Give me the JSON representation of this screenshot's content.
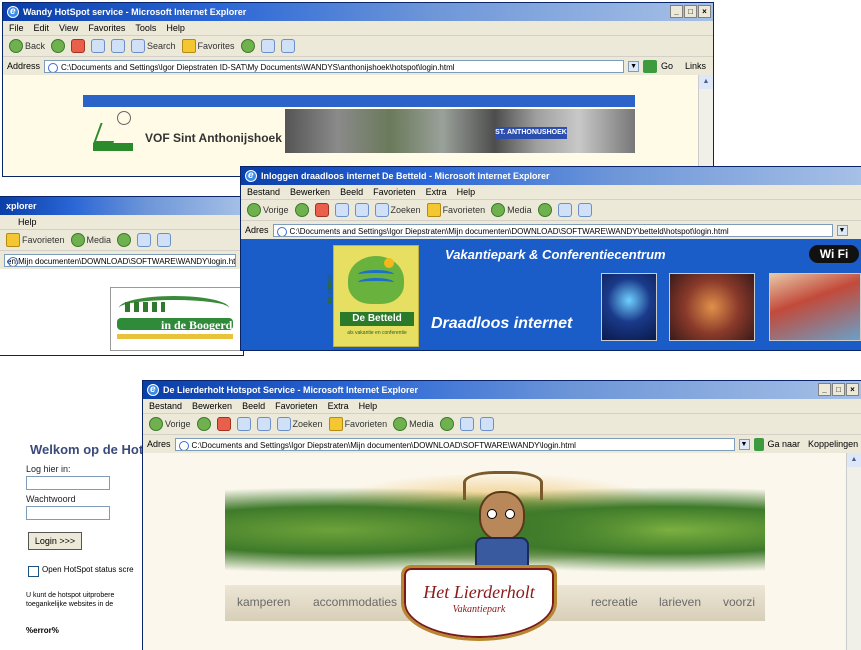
{
  "win1": {
    "title": "Wandy HotSpot service - Microsoft Internet Explorer",
    "menu": [
      "File",
      "Edit",
      "View",
      "Favorites",
      "Tools",
      "Help"
    ],
    "toolbar": {
      "back": "Back",
      "search": "Search",
      "favorites": "Favorites"
    },
    "address_label": "Address",
    "address": "C:\\Documents and Settings\\Igor Diepstraten ID-SAT\\My Documents\\WANDYS\\anthonijshoek\\hotspot\\login.html",
    "go": "Go",
    "links": "Links",
    "site_name": "VOF Sint Anthonijshoek",
    "photo_caption": "ST. ANTHONUSHOEK"
  },
  "win2": {
    "title": "xplorer",
    "menu_help": "Help",
    "toolbar": {
      "favorites": "Favorieten",
      "media": "Media"
    },
    "address": "en\\Mijn documenten\\DOWNLOAD\\SOFTWARE\\WANDY\\login.htm",
    "logo_text": "in de Boogerd"
  },
  "win3": {
    "title": "Inloggen draadloos internet De Betteld - Microsoft Internet Explorer",
    "menu": [
      "Bestand",
      "Bewerken",
      "Beeld",
      "Favorieten",
      "Extra",
      "Help"
    ],
    "toolbar": {
      "back": "Vorige",
      "search": "Zoeken",
      "favorites": "Favorieten",
      "media": "Media"
    },
    "address_label": "Adres",
    "address": "C:\\Documents and Settings\\Igor Diepstraten\\Mijn documenten\\DOWNLOAD\\SOFTWARE\\WANDY\\betteld\\hotspot\\login.html",
    "headline": "Vakantiepark & Conferentiecentrum",
    "subline": "Draadloos internet",
    "logo_name": "De Betteld",
    "logo_vertical": "de-betteld",
    "logo_tagline": "als vakantie en conferentie",
    "wifi_badge": "Wi Fi"
  },
  "win4": {
    "title": "De Lierderholt Hotspot Service - Microsoft Internet Explorer",
    "menu": [
      "Bestand",
      "Bewerken",
      "Beeld",
      "Favorieten",
      "Extra",
      "Help"
    ],
    "toolbar": {
      "back": "Vorige",
      "search": "Zoeken",
      "favorites": "Favorieten",
      "media": "Media"
    },
    "address_label": "Adres",
    "address": "C:\\Documents and Settings\\Igor Diepstraten\\Mijn documenten\\DOWNLOAD\\SOFTWARE\\WANDY\\login.html",
    "go": "Ga naar",
    "links": "Koppelingen",
    "logo_title": "Het Lierderholt",
    "logo_subtitle": "Vakantiepark",
    "nav": [
      "kamperen",
      "accommodaties",
      "recreatie",
      "larieven",
      "voorzi"
    ]
  },
  "login_panel": {
    "welcome": "Welkom op de HotSp",
    "login_here": "Log hier in:",
    "password_label": "Wachtwoord",
    "login_button": "Login >>>",
    "status_checkbox": "Open HotSpot status scre",
    "info_line1": "U kunt de hotspot uitprobere",
    "info_line2": "toegankelijke websites in de",
    "error_label": "%error%"
  },
  "colors": {
    "xp_title_blue": "#0a3ea8",
    "betteld_blue": "#1a5cc8",
    "brand_green": "#6ab23e",
    "boogerd_green": "#2f8a3a"
  }
}
